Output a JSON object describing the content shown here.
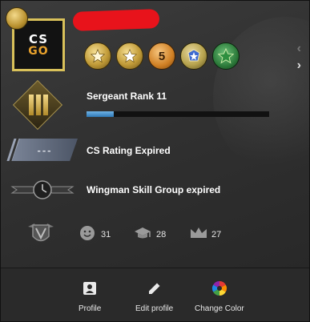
{
  "profile": {
    "avatar_logo": {
      "line1": "CS",
      "line2": "GO"
    },
    "medals": [
      {
        "icon": "gold-star-medal"
      },
      {
        "icon": "star-medal"
      },
      {
        "icon": "five-year-coin",
        "text": "5"
      },
      {
        "icon": "service-medal"
      },
      {
        "icon": "green-star-pin"
      }
    ],
    "rank": {
      "label": "Sergeant Rank 11",
      "progress": 0.15
    },
    "rating": {
      "badge_text": "---",
      "label": "CS Rating Expired"
    },
    "wingman": {
      "label": "Wingman Skill Group expired"
    },
    "commendations": {
      "friendly": "31",
      "teacher": "28",
      "leader": "27"
    }
  },
  "footer": {
    "profile_label": "Profile",
    "edit_label": "Edit profile",
    "color_label": "Change Color"
  },
  "colors": {
    "accent_gold": "#d9c15a",
    "progress_blue": "#4a9be0",
    "redaction": "#e8131b"
  }
}
